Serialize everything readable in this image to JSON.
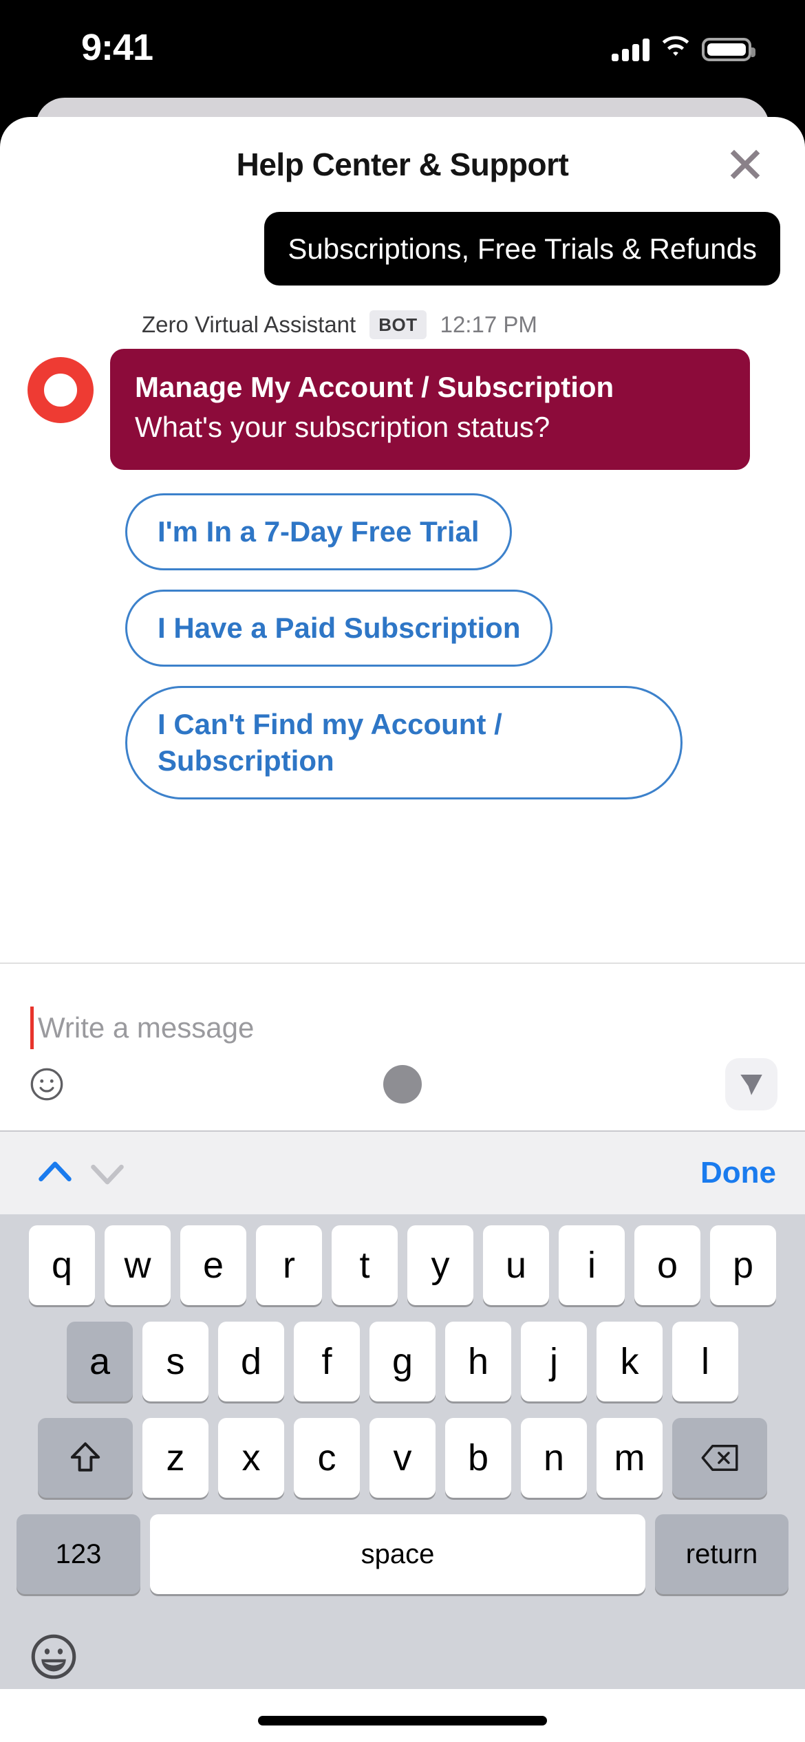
{
  "status_bar": {
    "time": "9:41",
    "signal_icon": "cellular-signal-icon",
    "wifi_icon": "wifi-icon",
    "battery_icon": "battery-icon"
  },
  "header": {
    "title": "Help Center & Support",
    "close_icon": "close-icon"
  },
  "chat": {
    "user_message": "Subscriptions, Free Trials & Refunds",
    "bot_meta": {
      "name": "Zero Virtual Assistant",
      "badge": "BOT",
      "time": "12:17 PM"
    },
    "bot_message": {
      "title": "Manage My Account / Subscription",
      "subtitle": "What's your subscription status?"
    },
    "quick_replies": [
      "I'm In a 7-Day Free Trial",
      "I Have a Paid Subscription",
      "I Can't Find my Account / Subscription"
    ]
  },
  "composer": {
    "placeholder": "Write a message",
    "value": "",
    "emoji_icon": "smiley-face-icon",
    "attach_icon": "attachment-circle-icon",
    "send_icon": "send-icon"
  },
  "keyboard_toolbar": {
    "prev_icon": "chevron-up-icon",
    "next_icon": "chevron-down-icon",
    "done_label": "Done"
  },
  "keyboard": {
    "row1": [
      "q",
      "w",
      "e",
      "r",
      "t",
      "y",
      "u",
      "i",
      "o",
      "p"
    ],
    "row2": [
      "a",
      "s",
      "d",
      "f",
      "g",
      "h",
      "j",
      "k",
      "l"
    ],
    "row3": [
      "z",
      "x",
      "c",
      "v",
      "b",
      "n",
      "m"
    ],
    "active_key": "a",
    "shift_icon": "shift-arrow-up-icon",
    "backspace_icon": "backspace-delete-icon",
    "numbers_label": "123",
    "space_label": "space",
    "return_label": "return",
    "emoji_key_icon": "emoji-smiley-icon"
  },
  "colors": {
    "bot_bubble": "#8C0B3A",
    "user_bubble": "#000000",
    "avatar_ring": "#EE3B33",
    "reply_blue": "#2E76C6",
    "done_blue": "#1A7BEE",
    "caret_red": "#E8342C"
  }
}
